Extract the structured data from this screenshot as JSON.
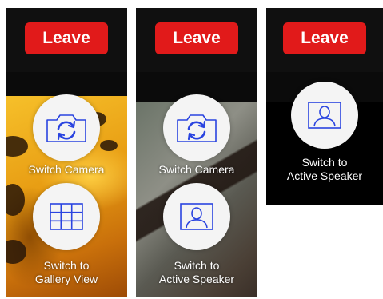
{
  "colors": {
    "leave_bg": "#e11a1a",
    "icon_stroke": "#2a44e0",
    "circle_bg": "#f4f4f4",
    "label_text": "#ffffff"
  },
  "panels": [
    {
      "leave_label": "Leave",
      "actions": [
        {
          "icon": "switch-camera-icon",
          "lines": [
            "Switch Camera"
          ]
        },
        {
          "icon": "gallery-view-icon",
          "lines": [
            "Switch to",
            "Gallery View"
          ]
        }
      ]
    },
    {
      "leave_label": "Leave",
      "actions": [
        {
          "icon": "switch-camera-icon",
          "lines": [
            "Switch Camera"
          ]
        },
        {
          "icon": "active-speaker-icon",
          "lines": [
            "Switch to",
            "Active Speaker"
          ]
        }
      ]
    },
    {
      "leave_label": "Leave",
      "actions": [
        {
          "icon": "active-speaker-icon",
          "lines": [
            "Switch to",
            "Active Speaker"
          ]
        }
      ]
    }
  ]
}
